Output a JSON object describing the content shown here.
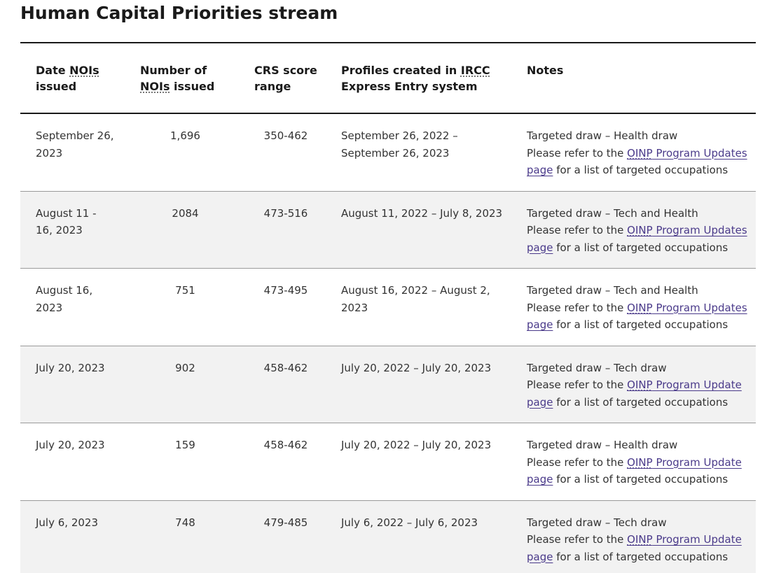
{
  "title": "Human Capital Priorities stream",
  "headers": {
    "date": [
      "Date ",
      "NOIs",
      " issued"
    ],
    "number": [
      "Number of ",
      "NOIs",
      " issued"
    ],
    "crs": [
      "CRS",
      " score range"
    ],
    "profiles": [
      "Profiles created in ",
      "IRCC",
      " Express Entry system"
    ],
    "notes": "Notes"
  },
  "rows": [
    {
      "date": "September 26, 2023",
      "number": "1,696",
      "crs": "350-462",
      "profiles": "September 26, 2022 – September 26, 2023",
      "note_line1": "Targeted draw – Health draw",
      "note_prefix": "Please refer to the ",
      "note_link_abbr": "OINP",
      "note_link_text": " Program Updates page",
      "note_suffix": " for a list of targeted occupations"
    },
    {
      "date": "August 11 - 16, 2023",
      "number": "2084",
      "crs": "473-516",
      "profiles": "August 11, 2022 – July 8, 2023",
      "note_line1": "Targeted draw – Tech and Health",
      "note_prefix": "Please refer to the ",
      "note_link_abbr": "OINP",
      "note_link_text": " Program Updates page",
      "note_suffix": " for a list of targeted occupations"
    },
    {
      "date": "August 16, 2023",
      "number": "751",
      "crs": "473-495",
      "profiles": "August 16, 2022 – August 2, 2023",
      "note_line1": "Targeted draw – Tech and Health",
      "note_prefix": "Please refer to the ",
      "note_link_abbr": "OINP",
      "note_link_text": " Program Updates page",
      "note_suffix": " for a list of targeted occupations"
    },
    {
      "date": "July 20, 2023",
      "number": "902",
      "crs": "458-462",
      "profiles": "July 20, 2022 – July 20, 2023",
      "note_line1": "Targeted draw – Tech draw",
      "note_prefix": "Please refer to the ",
      "note_link_abbr": "OINP",
      "note_link_text": " Program Update page",
      "note_suffix": " for a list of targeted occupations"
    },
    {
      "date": "July 20, 2023",
      "number": "159",
      "crs": "458-462",
      "profiles": "July 20, 2022 – July 20, 2023",
      "note_line1": "Targeted draw – Health draw",
      "note_prefix": "Please refer to the ",
      "note_link_abbr": "OINP",
      "note_link_text": " Program Update page",
      "note_suffix": " for a list of targeted occupations"
    },
    {
      "date": "July 6, 2023",
      "number": "748",
      "crs": "479-485",
      "profiles": "July 6, 2022 – July 6, 2023",
      "note_line1": "Targeted draw – Tech draw",
      "note_prefix": "Please refer to the ",
      "note_link_abbr": "OINP",
      "note_link_text": " Program Update page",
      "note_suffix": " for a list of targeted occupations"
    }
  ]
}
